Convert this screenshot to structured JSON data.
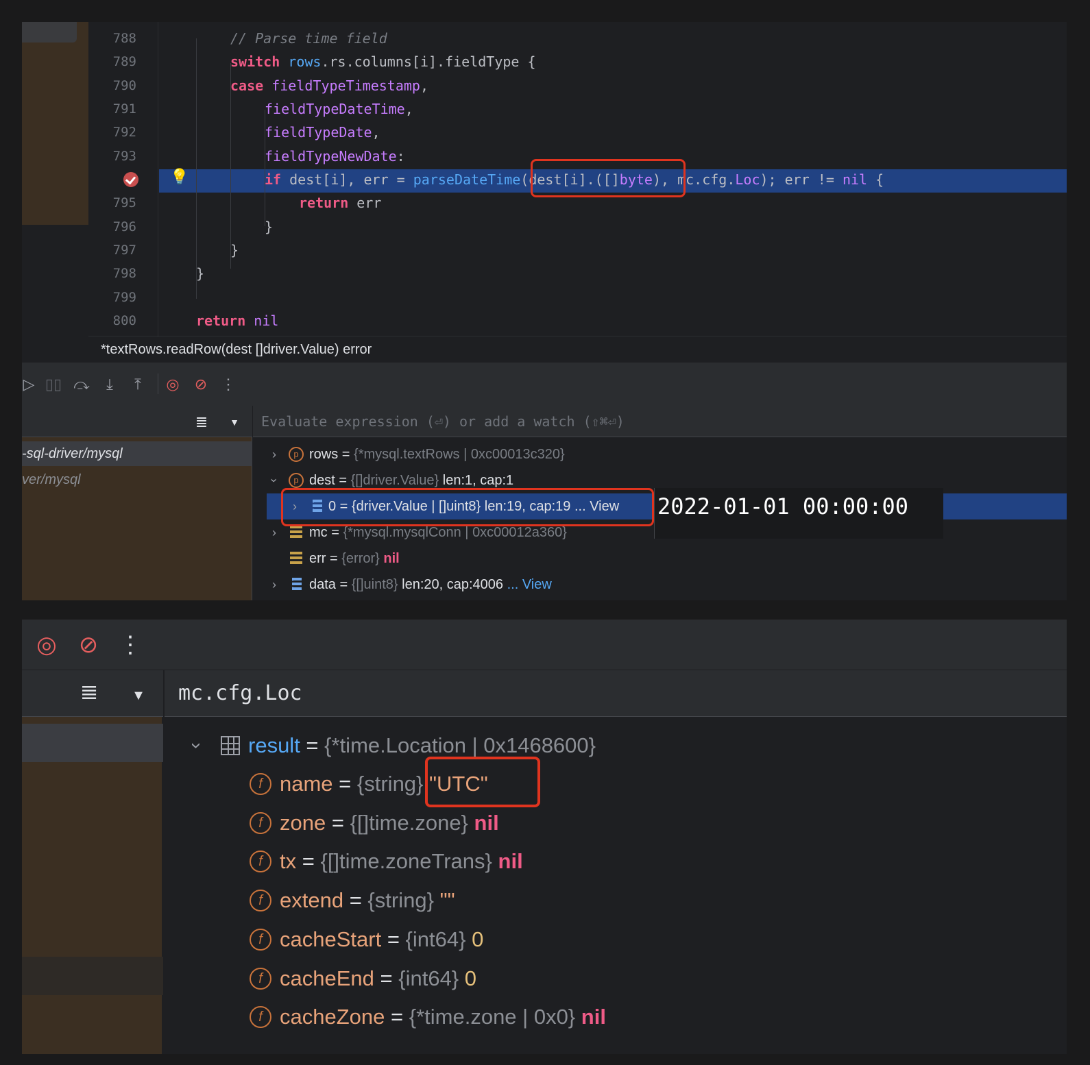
{
  "editor": {
    "line_numbers": [
      "788",
      "789",
      "790",
      "791",
      "792",
      "793",
      "",
      "795",
      "796",
      "797",
      "798",
      "799",
      "800"
    ],
    "code_lines": [
      {
        "id": "l788",
        "tokens": [
          {
            "t": "// Parse time field",
            "c": "cm"
          }
        ]
      },
      {
        "id": "l789",
        "tokens": [
          {
            "t": "switch",
            "c": "kw"
          },
          {
            "t": " "
          },
          {
            "t": "rows",
            "c": "fn"
          },
          {
            "t": ".rs.columns[i].fieldType {"
          }
        ]
      },
      {
        "id": "l790",
        "tokens": [
          {
            "t": "case",
            "c": "kw"
          },
          {
            "t": " "
          },
          {
            "t": "fieldTypeTimestamp",
            "c": "cst"
          },
          {
            "t": ","
          }
        ]
      },
      {
        "id": "l791",
        "tokens": [
          {
            "t": "fieldTypeDateTime",
            "c": "cst"
          },
          {
            "t": ","
          }
        ]
      },
      {
        "id": "l792",
        "tokens": [
          {
            "t": "fieldTypeDate",
            "c": "cst"
          },
          {
            "t": ","
          }
        ]
      },
      {
        "id": "l793",
        "tokens": [
          {
            "t": "fieldTypeNewDate",
            "c": "cst"
          },
          {
            "t": ":"
          }
        ]
      },
      {
        "id": "l794",
        "tokens": [
          {
            "t": "if",
            "c": "kw"
          },
          {
            "t": " dest[i], err = "
          },
          {
            "t": "parseDateTime",
            "c": "fn"
          },
          {
            "t": "(dest[i].([]"
          },
          {
            "t": "byte",
            "c": "cst"
          },
          {
            "t": "), mc.cfg."
          },
          {
            "t": "Loc",
            "c": "cst"
          },
          {
            "t": "); err != "
          },
          {
            "t": "nil",
            "c": "cst"
          },
          {
            "t": " {"
          }
        ]
      },
      {
        "id": "l795",
        "tokens": [
          {
            "t": "return",
            "c": "kw"
          },
          {
            "t": " err"
          }
        ]
      },
      {
        "id": "l796",
        "tokens": [
          {
            "t": "}"
          }
        ]
      },
      {
        "id": "l797",
        "tokens": [
          {
            "t": "}"
          }
        ]
      },
      {
        "id": "l798",
        "tokens": [
          {
            "t": "}"
          }
        ]
      },
      {
        "id": "l799",
        "tokens": []
      },
      {
        "id": "l800",
        "tokens": [
          {
            "t": "return",
            "c": "kw"
          },
          {
            "t": " "
          },
          {
            "t": "nil",
            "c": "cst"
          }
        ]
      }
    ],
    "breadcrumb": "*textRows.readRow(dest []driver.Value) error"
  },
  "debugger": {
    "toolbar_icons": [
      "resume-icon",
      "pause-icon",
      "step-over-icon",
      "step-into-icon",
      "step-out-icon",
      "view-breakpoints-icon",
      "mute-breakpoints-icon",
      "more-icon"
    ],
    "frames": [
      "-sql-driver/mysql",
      "ver/mysql"
    ],
    "eval_placeholder": "Evaluate expression (⏎) or add a watch (⇧⌘⏎)",
    "variables": {
      "rows": {
        "name": "rows",
        "eq": " = ",
        "type": "{*mysql.textRows | 0xc00013c320}"
      },
      "dest": {
        "name": "dest",
        "eq": " = ",
        "type": "{[]driver.Value}",
        "value": " len:1, cap:1"
      },
      "dest0": {
        "text": "0 = {driver.Value | []uint8} len:19, cap:19 ... View"
      },
      "mc": {
        "name": "mc",
        "eq": " = ",
        "type": "{*mysql.mysqlConn | 0xc00012a360}"
      },
      "err": {
        "name": "err",
        "eq": " = ",
        "type": "{error}",
        "value": " nil"
      },
      "data": {
        "name": "data",
        "eq": " = ",
        "type": "{[]uint8}",
        "value": " len:20, cap:4006",
        "link": " ... View"
      }
    },
    "tooltip_value": "2022-01-01 00:00:00"
  },
  "bottom": {
    "expression": "mc.cfg.Loc",
    "result": {
      "name": "result",
      "eq": " = ",
      "type": "{*time.Location | 0x1468600}"
    },
    "fields": [
      {
        "name": "name",
        "type": "{string}",
        "value": "\"UTC\"",
        "kind": "str"
      },
      {
        "name": "zone",
        "type": "{[]time.zone}",
        "value": "nil",
        "kind": "nil"
      },
      {
        "name": "tx",
        "type": "{[]time.zoneTrans}",
        "value": "nil",
        "kind": "nil"
      },
      {
        "name": "extend",
        "type": "{string}",
        "value": "\"\"",
        "kind": "str"
      },
      {
        "name": "cacheStart",
        "type": "{int64}",
        "value": "0",
        "kind": "num"
      },
      {
        "name": "cacheEnd",
        "type": "{int64}",
        "value": "0",
        "kind": "num"
      },
      {
        "name": "cacheZone",
        "type": "{*time.zone | 0x0}",
        "value": "nil",
        "kind": "nil"
      }
    ],
    "field_icon_letter": "f"
  },
  "colors": {
    "highlight_box": "#e0341f",
    "execution_line": "#214283",
    "frame_bg": "#3b2f22"
  }
}
